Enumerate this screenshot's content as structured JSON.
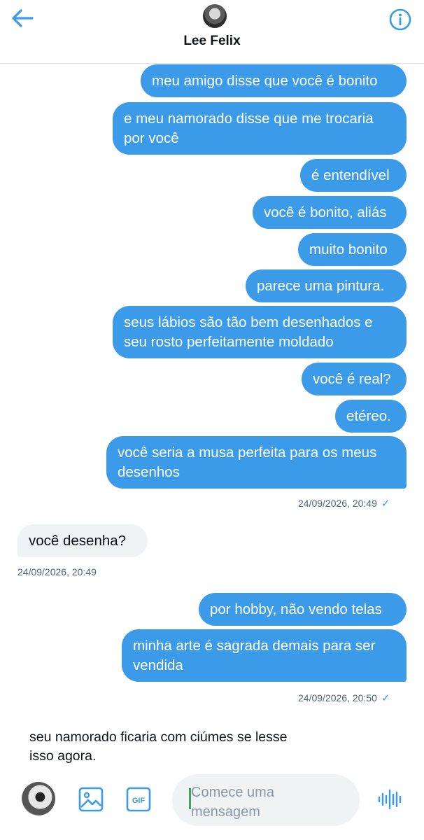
{
  "header": {
    "name": "Lee Felix",
    "back_icon": "arrow-left-icon",
    "info_icon": "info-icon"
  },
  "messages": [
    {
      "text": "meu amigo disse que você é bonito"
    },
    {
      "text": "e meu namorado disse que me trocaria por você"
    },
    {
      "text": "é entendível"
    },
    {
      "text": "você é bonito, aliás"
    },
    {
      "text": "muito bonito"
    },
    {
      "text": "parece uma pintura."
    },
    {
      "text": "seus lábios são tão bem desenhados e seu rosto perfeitamente moldado"
    },
    {
      "text": "você é real?"
    },
    {
      "text": "etéreo."
    },
    {
      "text": "você seria a musa perfeita para os meus desenhos"
    },
    {
      "text": "você desenha?"
    },
    {
      "text": "por hobby, não vendo telas"
    },
    {
      "text": "minha arte é sagrada demais para ser vendida"
    }
  ],
  "timestamps": {
    "t1": "24/09/2026, 20:49",
    "t2": "24/09/2026, 20:49",
    "t3": "24/09/2026, 20:50"
  },
  "check_mark": "✓",
  "draft_preview": "seu namorado ficaria com ciúmes se lesse isso agora.",
  "composer": {
    "placeholder": "Comece uma mensagem",
    "image_icon": "image-icon",
    "gif_label": "GIF",
    "voice_icon": "voice-waveform-icon"
  },
  "colors": {
    "outgoing_bubble": "#3b9be8",
    "incoming_bubble": "#eff3f4",
    "accent": "#1d9bf0"
  }
}
